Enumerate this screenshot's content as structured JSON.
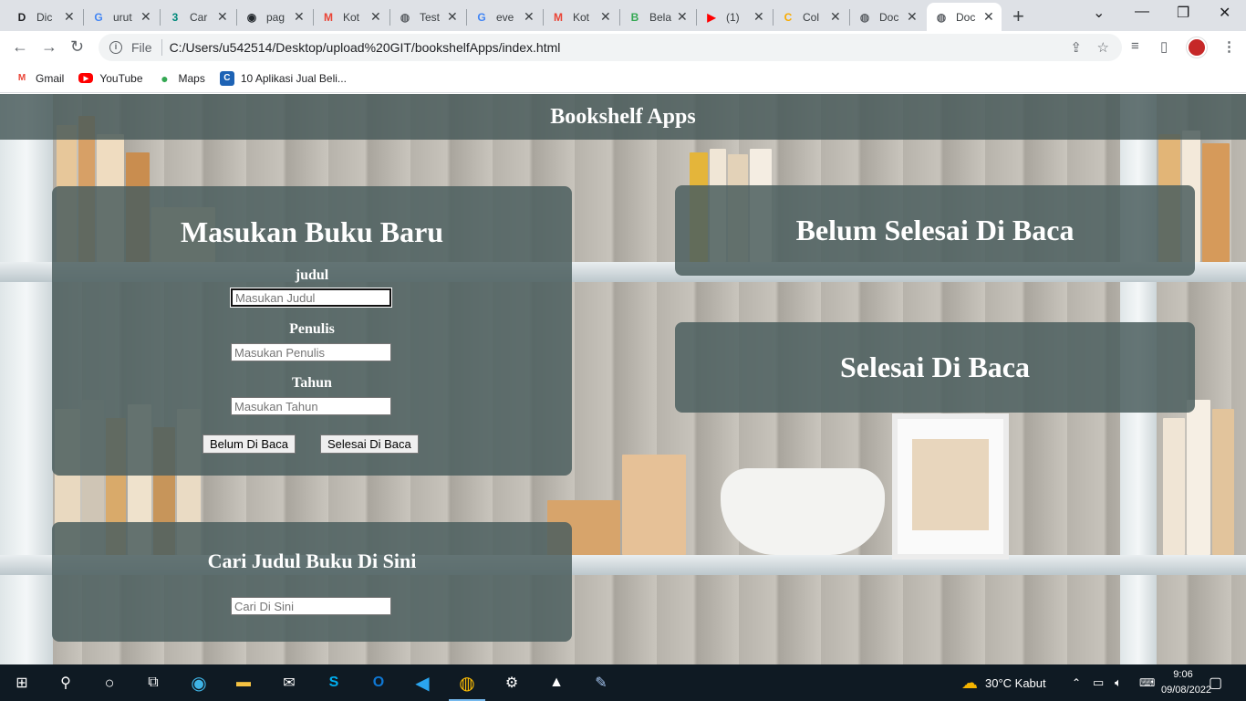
{
  "browser": {
    "tabs": [
      {
        "title": "Dic",
        "favicon": "D",
        "color": "#202124"
      },
      {
        "title": "urut",
        "favicon": "G",
        "color": "#4285f4"
      },
      {
        "title": "Car",
        "favicon": "3",
        "color": "#00897b"
      },
      {
        "title": "pag",
        "favicon": "gh",
        "color": "#24292e"
      },
      {
        "title": "Kot",
        "favicon": "M",
        "color": "#ea4335"
      },
      {
        "title": "Test",
        "favicon": "globe",
        "color": "#5f6368"
      },
      {
        "title": "eve",
        "favicon": "G",
        "color": "#4285f4"
      },
      {
        "title": "Kot",
        "favicon": "M",
        "color": "#ea4335"
      },
      {
        "title": "Bela",
        "favicon": "B",
        "color": "#34a853"
      },
      {
        "title": "(1)",
        "favicon": "▶",
        "color": "#ff0000"
      },
      {
        "title": "Col",
        "favicon": "C",
        "color": "#f9ab00"
      },
      {
        "title": "Doc",
        "favicon": "globe",
        "color": "#5f6368"
      },
      {
        "title": "Doc",
        "favicon": "globe",
        "color": "#5f6368",
        "active": true
      }
    ],
    "address": {
      "protocol": "File",
      "url": "C:/Users/u542514/Desktop/upload%20GIT/bookshelfApps/index.html"
    },
    "bookmarks": [
      {
        "label": "Gmail",
        "icon": "gmail-icon"
      },
      {
        "label": "YouTube",
        "icon": "youtube-icon"
      },
      {
        "label": "Maps",
        "icon": "maps-icon"
      },
      {
        "label": "10 Aplikasi Jual Beli...",
        "icon": "site-icon"
      }
    ]
  },
  "app": {
    "header_title": "Bookshelf Apps",
    "input_section": {
      "title": "Masukan Buku Baru",
      "title_label": "judul",
      "title_placeholder": "Masukan Judul",
      "author_label": "Penulis",
      "author_placeholder": "Masukan Penulis",
      "year_label": "Tahun",
      "year_placeholder": "Masukan Tahun",
      "unread_button": "Belum Di Baca",
      "read_button": "Selesai Di Baca"
    },
    "search_section": {
      "title": "Cari Judul Buku Di Sini",
      "placeholder": "Cari Di Sini"
    },
    "incomplete_section": {
      "title": "Belum Selesai Di Baca"
    },
    "complete_section": {
      "title": "Selesai Di Baca"
    }
  },
  "taskbar": {
    "weather": "30°C  Kabut",
    "time": "9:06",
    "date": "09/08/2022"
  }
}
